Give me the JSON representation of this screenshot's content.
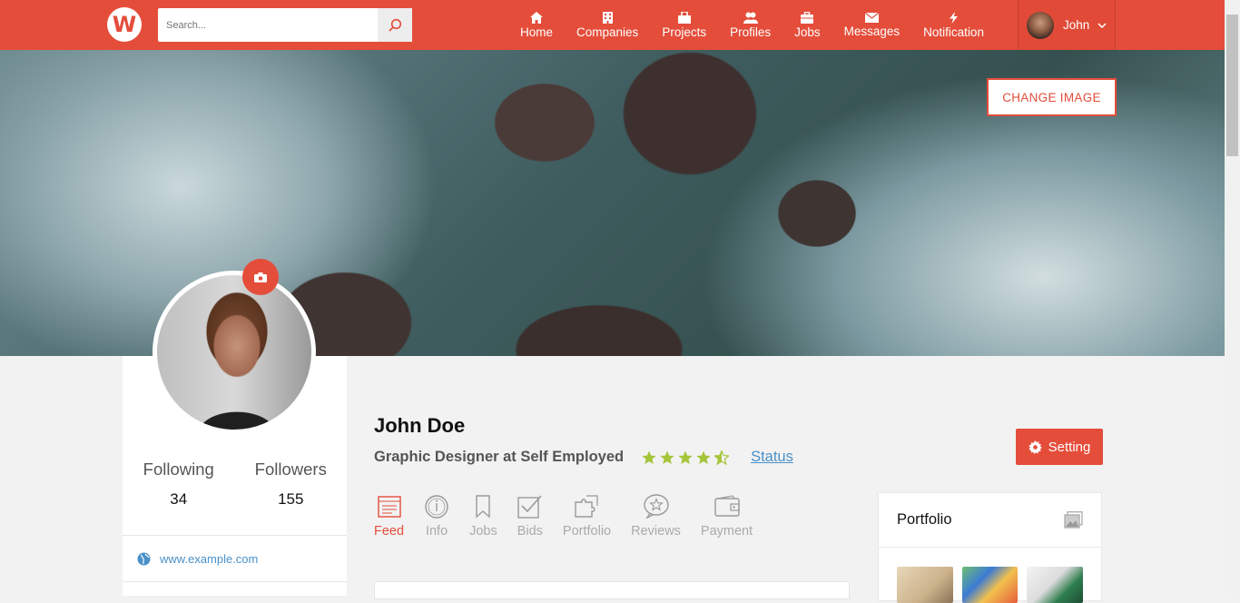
{
  "header": {
    "logo": "W",
    "search_placeholder": "Search...",
    "nav": [
      {
        "label": "Home",
        "icon": "home-icon"
      },
      {
        "label": "Companies",
        "icon": "building-icon"
      },
      {
        "label": "Projects",
        "icon": "projects-icon"
      },
      {
        "label": "Profiles",
        "icon": "users-icon"
      },
      {
        "label": "Jobs",
        "icon": "briefcase-icon"
      },
      {
        "label": "Messages",
        "icon": "envelope-icon"
      },
      {
        "label": "Notification",
        "icon": "bolt-icon"
      }
    ],
    "user_name": "John"
  },
  "cover": {
    "change_image_label": "CHANGE IMAGE"
  },
  "sidebar": {
    "following_label": "Following",
    "following_count": "34",
    "followers_label": "Followers",
    "followers_count": "155",
    "website": "www.example.com"
  },
  "profile": {
    "name": "John Doe",
    "headline": "Graphic Designer at Self Employed",
    "rating": 4.5,
    "status_label": "Status",
    "setting_label": "Setting"
  },
  "tabs": [
    {
      "label": "Feed",
      "active": true
    },
    {
      "label": "Info"
    },
    {
      "label": "Jobs"
    },
    {
      "label": "Bids"
    },
    {
      "label": "Portfolio"
    },
    {
      "label": "Reviews"
    },
    {
      "label": "Payment"
    }
  ],
  "portfolio": {
    "title": "Portfolio"
  },
  "colors": {
    "accent": "#e44d3a",
    "link": "#4a90c8",
    "star": "#a6c63a"
  }
}
